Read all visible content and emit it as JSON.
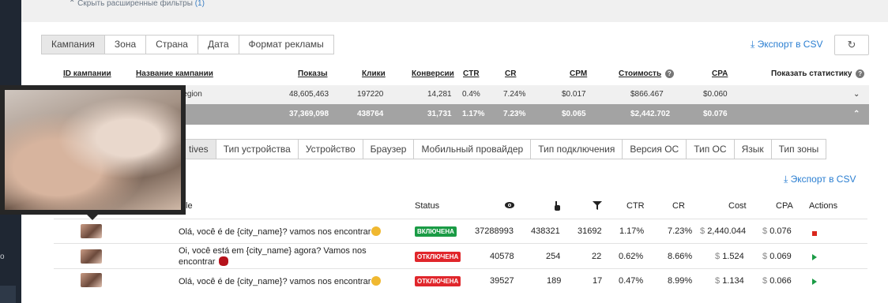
{
  "filters_toggle": {
    "label": "Скрыть расширенные фильтры",
    "count": "(1)"
  },
  "group_tabs": [
    "Кампания",
    "Зона",
    "Страна",
    "Дата",
    "Формат рекламы"
  ],
  "export_label": "Экспорт в CSV",
  "stats_headers": {
    "campaign_id": "ID кампании",
    "campaign_name": "Название кампании",
    "impressions": "Показы",
    "clicks": "Клики",
    "conversions": "Конверсии",
    "ctr": "CTR",
    "cr": "CR",
    "cpm": "CPM",
    "cost": "Стоимость",
    "cpa": "CPA",
    "show_stats": "Показать статистику"
  },
  "stats_rows": [
    {
      "name": "region",
      "impressions": "48,605,463",
      "clicks": "197220",
      "conversions": "14,281",
      "ctr": "0.4%",
      "cr": "7.24%",
      "cpm": "$0.017",
      "cost": "$866.467",
      "cpa": "$0.060"
    },
    {
      "impressions": "37,369,098",
      "clicks": "438764",
      "conversions": "31,731",
      "ctr": "1.17%",
      "cr": "7.23%",
      "cpm": "$0.065",
      "cost": "$2,442.702",
      "cpa": "$0.076"
    }
  ],
  "detail_tabs": [
    "tives",
    "Тип устройства",
    "Устройство",
    "Браузер",
    "Мобильный провайдер",
    "Тип подключения",
    "Версия ОС",
    "Тип ОС",
    "Язык",
    "Тип зоны"
  ],
  "creative_headers": {
    "title": "tle",
    "status": "Status",
    "impressions_icon": "eye-icon",
    "clicks_icon": "pointer-icon",
    "conversions_icon": "funnel-icon",
    "ctr": "CTR",
    "cr": "CR",
    "cost": "Cost",
    "cpa": "CPA",
    "actions": "Actions"
  },
  "creatives": [
    {
      "title": "Olá, você é de {city_name}? vamos nos encontrar",
      "emoji": "face-emoji",
      "status": "ВКЛЮЧЕНА",
      "status_color": "#1a9b45",
      "impressions": "37288993",
      "clicks": "438321",
      "conversions": "31692",
      "ctr": "1.17%",
      "cr": "7.23%",
      "cost_cur": "$",
      "cost": "2,440.044",
      "cpa_cur": "$",
      "cpa": "0.076",
      "action": "stop"
    },
    {
      "title": "Oi, você está em {city_name} agora? Vamos nos",
      "title2": "encontrar",
      "emoji": "lips-emoji",
      "status": "ОТКЛЮЧЕНА",
      "status_color": "#e0262b",
      "impressions": "40578",
      "clicks": "254",
      "conversions": "22",
      "ctr": "0.62%",
      "cr": "8.66%",
      "cost_cur": "$",
      "cost": "1.524",
      "cpa_cur": "$",
      "cpa": "0.069",
      "action": "play"
    },
    {
      "title": "Olá, você é de {city_name}? vamos nos encontrar",
      "emoji": "face-emoji",
      "status": "ОТКЛЮЧЕНА",
      "status_color": "#e0262b",
      "impressions": "39527",
      "clicks": "189",
      "conversions": "17",
      "ctr": "0.47%",
      "cr": "8.99%",
      "cost_cur": "$",
      "cost": "1.134",
      "cpa_cur": "$",
      "cpa": "0.066",
      "action": "play"
    }
  ],
  "left_sidebar_text": "o"
}
